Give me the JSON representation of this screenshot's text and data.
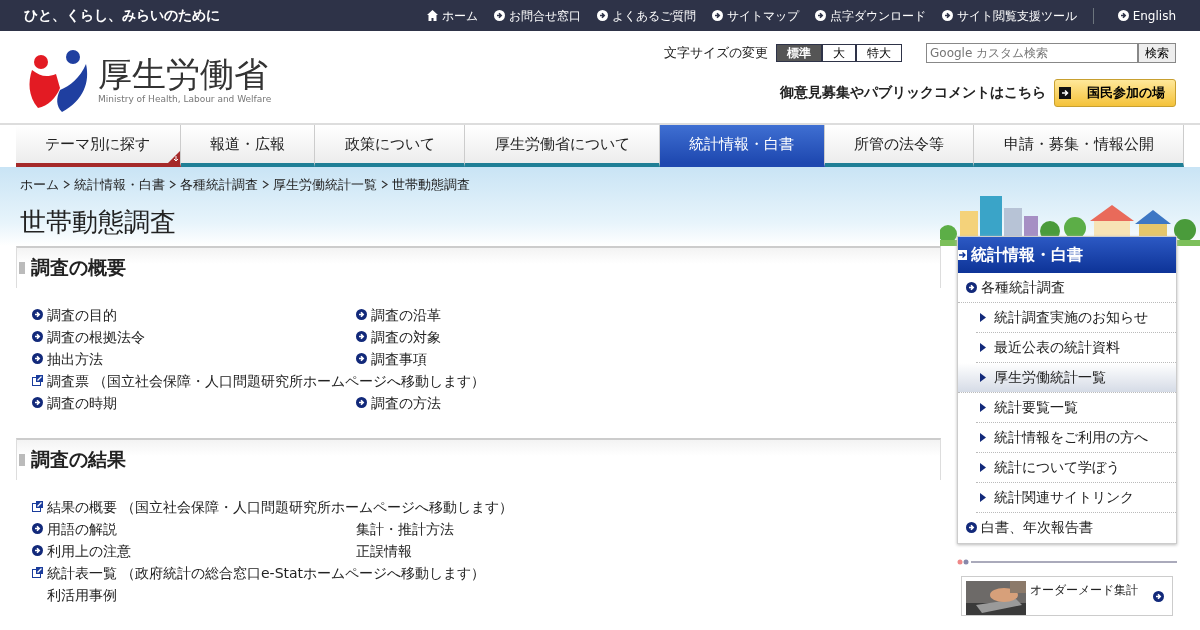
{
  "topbar": {
    "tagline": "ひと、くらし、みらいのために",
    "links": [
      {
        "text": "ホーム",
        "kind": "home"
      },
      {
        "text": "お問合せ窓口",
        "kind": "link"
      },
      {
        "text": "よくあるご質問",
        "kind": "link"
      },
      {
        "text": "サイトマップ",
        "kind": "link"
      },
      {
        "text": "点字ダウンロード",
        "kind": "link"
      },
      {
        "text": "サイト閲覧支援ツール",
        "kind": "link"
      },
      {
        "text": "English",
        "kind": "language"
      }
    ]
  },
  "header": {
    "logo_text": "厚生労働省",
    "logo_subtext": "Ministry of Health, Labour and Welfare",
    "font_size_label": "文字サイズの変更",
    "font_sizes": [
      {
        "label": "標準",
        "selected": true
      },
      {
        "label": "大",
        "selected": false
      },
      {
        "label": "特大",
        "selected": false
      }
    ],
    "search": {
      "placeholder": "Google カスタム検索",
      "button": "検索"
    },
    "participation_text": "御意見募集やパブリックコメントはこちら",
    "participation_button": "国民参加の場"
  },
  "nav": [
    {
      "label": "テーマ別に探す",
      "kind": "menu",
      "selected": false
    },
    {
      "label": "報道・広報",
      "kind": "link",
      "selected": false
    },
    {
      "label": "政策について",
      "kind": "link",
      "selected": false
    },
    {
      "label": "厚生労働省について",
      "kind": "link",
      "selected": false
    },
    {
      "label": "統計情報・白書",
      "kind": "link",
      "selected": true
    },
    {
      "label": "所管の法令等",
      "kind": "link",
      "selected": false
    },
    {
      "label": "申請・募集・情報公開",
      "kind": "link",
      "selected": false
    }
  ],
  "breadcrumb": {
    "links": [
      "ホーム",
      "統計情報・白書",
      "各種統計調査",
      "厚生労働統計一覧"
    ],
    "current": "世帯動態調査"
  },
  "page_title": "世帯動態調査",
  "sections": [
    {
      "title": "調査の概要",
      "rows": [
        {
          "left": {
            "text": "調査の目的",
            "kind": "internal"
          },
          "right": {
            "text": "調査の沿革",
            "kind": "internal"
          }
        },
        {
          "left": {
            "text": "調査の根拠法令",
            "kind": "internal"
          },
          "right": {
            "text": "調査の対象",
            "kind": "internal"
          }
        },
        {
          "left": {
            "text": "抽出方法",
            "kind": "internal"
          },
          "right": {
            "text": "調査事項",
            "kind": "internal"
          }
        },
        {
          "left": {
            "text": "調査票",
            "kind": "external",
            "note": "（国立社会保障・人口問題研究所ホームページへ移動します）"
          }
        },
        {
          "left": {
            "text": "調査の時期",
            "kind": "internal"
          },
          "right": {
            "text": "調査の方法",
            "kind": "internal"
          }
        }
      ]
    },
    {
      "title": "調査の結果",
      "rows": [
        {
          "left": {
            "text": "結果の概要",
            "kind": "external",
            "note": "（国立社会保障・人口問題研究所ホームページへ移動します）"
          }
        },
        {
          "left": {
            "text": "用語の解説",
            "kind": "internal"
          },
          "right": {
            "text": "集計・推計方法",
            "kind": "plain"
          }
        },
        {
          "left": {
            "text": "利用上の注意",
            "kind": "internal"
          },
          "right": {
            "text": "正誤情報",
            "kind": "plain"
          }
        },
        {
          "left": {
            "text": "統計表一覧",
            "kind": "external",
            "note": "（政府統計の総合窓口e-Statホームページへ移動します）"
          }
        },
        {
          "left": {
            "text": "利活用事例",
            "kind": "plain"
          }
        }
      ]
    }
  ],
  "sidebar": {
    "title": "統計情報・白書",
    "items": [
      {
        "text": "各種統計調査",
        "children": [
          {
            "text": "統計調査実施のお知らせ",
            "selected": false
          },
          {
            "text": "最近公表の統計資料",
            "selected": false
          },
          {
            "text": "厚生労働統計一覧",
            "selected": true
          },
          {
            "text": "統計要覧一覧",
            "selected": false
          },
          {
            "text": "統計情報をご利用の方へ",
            "selected": false
          },
          {
            "text": "統計について学ぼう",
            "selected": false
          },
          {
            "text": "統計関連サイトリンク",
            "selected": false
          }
        ]
      },
      {
        "text": "白書、年次報告書"
      }
    ],
    "banner": {
      "text": "オーダーメード集計"
    }
  }
}
